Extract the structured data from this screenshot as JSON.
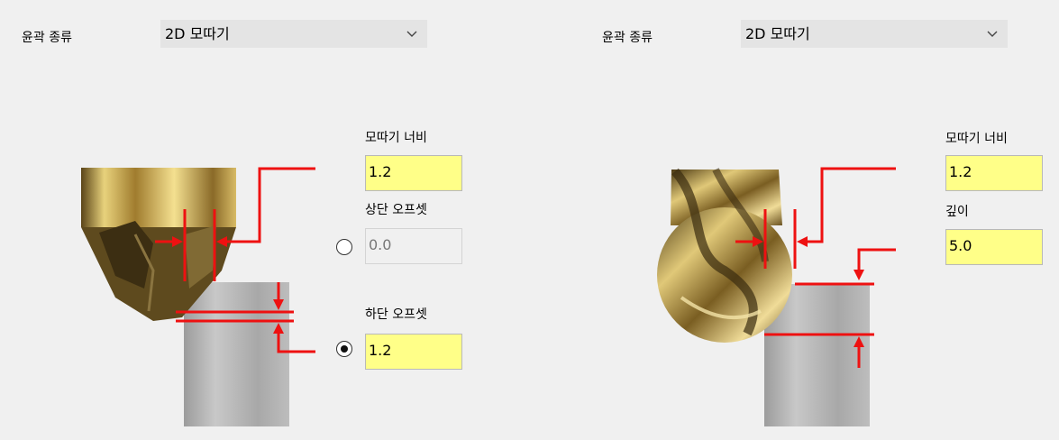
{
  "left": {
    "contour_type_label": "윤곽 종류",
    "contour_type_value": "2D 모따기",
    "width_label": "모따기 너비",
    "width_value": "1.2",
    "top_offset_label": "상단 오프셋",
    "top_offset_value": "0.0",
    "top_offset_selected": false,
    "bottom_offset_label": "하단 오프셋",
    "bottom_offset_value": "1.2",
    "bottom_offset_selected": true
  },
  "right": {
    "contour_type_label": "윤곽 종류",
    "contour_type_value": "2D 모따기",
    "width_label": "모따기 너비",
    "width_value": "1.2",
    "depth_label": "깊이",
    "depth_value": "5.0"
  },
  "colors": {
    "accent": "#ee1111",
    "field_bg": "#ffff88",
    "tool_gold": "#c9a24a",
    "stock_gray": "#b4b4b4"
  },
  "icons": [
    "chevron-down-icon",
    "chamfer-tool-icon",
    "ball-end-tool-icon"
  ]
}
